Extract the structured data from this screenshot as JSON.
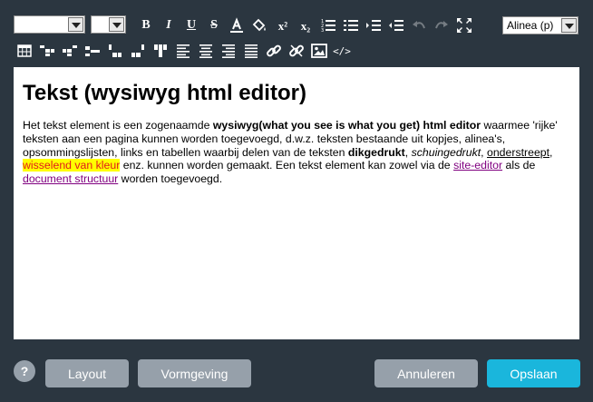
{
  "toolbar": {
    "font_family_value": "",
    "font_size_value": "",
    "paragraph_format_value": "Alinea (p)",
    "bold_label": "B",
    "italic_label": "I",
    "underline_label": "U",
    "strike_label": "S",
    "superscript_label": "x²",
    "subscript_label": "x₂",
    "source_label": "</>"
  },
  "editor": {
    "heading": "Tekst (wysiwyg html editor)",
    "p1": "Het tekst element is een zogenaamde ",
    "p_bold": "wysiwyg(what you see is what you get) html editor",
    "p2": " waarmee 'rijke' teksten aan een pagina kunnen worden toegevoegd, d.w.z. teksten bestaande uit kopjes, alinea's, opsommingslijsten, links en tabellen waarbij delen van de teksten ",
    "p_bold2": "dikgedrukt",
    "p3": ", ",
    "p_italic": "schuingedrukt",
    "p4": ", ",
    "p_underline": "onderstreept",
    "p5": ", ",
    "p_highlight": "wisselend van kleur",
    "p6": " enz. kunnen worden gemaakt. Een tekst element kan zowel via de ",
    "link1": "site-editor",
    "p7": " als de ",
    "link2": "document structuur",
    "p8": " worden toegevoegd."
  },
  "footer": {
    "help_label": "?",
    "layout_label": "Layout",
    "vormgeving_label": "Vormgeving",
    "cancel_label": "Annuleren",
    "save_label": "Opslaan"
  },
  "colors": {
    "background": "#2b3640",
    "button_grey": "#96a0aa",
    "button_primary": "#1ab6dc",
    "highlight_bg": "#ffff00",
    "highlight_text": "#e21a1a",
    "link": "#800080"
  }
}
